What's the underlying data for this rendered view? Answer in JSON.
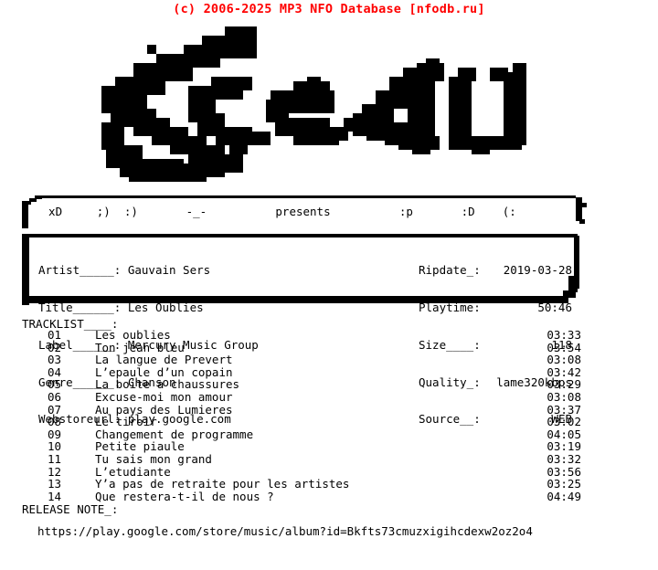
{
  "header": {
    "copyright": "(c) 2006-2025 MP3 NFO Database [nfodb.ru]",
    "color": "#ff0000"
  },
  "logo": {
    "text": "Sceau",
    "style": "pixel-ascii-art",
    "color": "#000000"
  },
  "presents_bar": {
    "items": [
      "xD",
      ";)",
      ":)",
      "-_-",
      "presents",
      ":p",
      ":D",
      "(:"
    ],
    "line": "  xD     ;)  :)       -_-          presents          :p       :D    (:"
  },
  "info": {
    "left": [
      {
        "label": "Artist_____:",
        "value": "Gauvain Sers"
      },
      {
        "label": "Title______:",
        "value": "Les Oublies"
      },
      {
        "label": "Label______:",
        "value": "Mercury Music Group"
      },
      {
        "label": "Genre______:",
        "value": "Chanson"
      },
      {
        "label": "Webstoreurl:",
        "value": "play.google.com"
      }
    ],
    "right": [
      {
        "label": "Ripdate_:",
        "value": "2019-03-28"
      },
      {
        "label": "Playtime:",
        "value": "50:46"
      },
      {
        "label": "Size____:",
        "value": "118"
      },
      {
        "label": "Quality_:",
        "value": "lame320kbps"
      },
      {
        "label": "Source__:",
        "value": "WEB"
      }
    ]
  },
  "tracklist": {
    "heading": "TRACKLIST____:",
    "tracks": [
      {
        "num": "01",
        "title": "Les oublies",
        "time": "03:33"
      },
      {
        "num": "02",
        "title": "Ton jean bleu",
        "time": "03:54"
      },
      {
        "num": "03",
        "title": "La langue de Prevert",
        "time": "03:08"
      },
      {
        "num": "04",
        "title": "L’epaule d’un copain",
        "time": "03:42"
      },
      {
        "num": "05",
        "title": "La boite a chaussures",
        "time": "03:29"
      },
      {
        "num": "06",
        "title": "Excuse-moi mon amour",
        "time": "03:08"
      },
      {
        "num": "07",
        "title": "Au pays des Lumieres",
        "time": "03:37"
      },
      {
        "num": "08",
        "title": "Le tiroir",
        "time": "03:02"
      },
      {
        "num": "09",
        "title": "Changement de programme",
        "time": "04:05"
      },
      {
        "num": "10",
        "title": "Petite piaule",
        "time": "03:19"
      },
      {
        "num": "11",
        "title": "Tu sais mon grand",
        "time": "03:32"
      },
      {
        "num": "12",
        "title": "L’etudiante",
        "time": "03:56"
      },
      {
        "num": "13",
        "title": "Y’a pas de retraite pour les artistes",
        "time": "03:25"
      },
      {
        "num": "14",
        "title": "Que restera-t-il de nous ?",
        "time": "04:49"
      }
    ]
  },
  "release_note": {
    "heading": "RELEASE NOTE_:",
    "url": "https://play.google.com/store/music/album?id=Bkfts73cmuzxigihcdexw2oz2o4"
  }
}
